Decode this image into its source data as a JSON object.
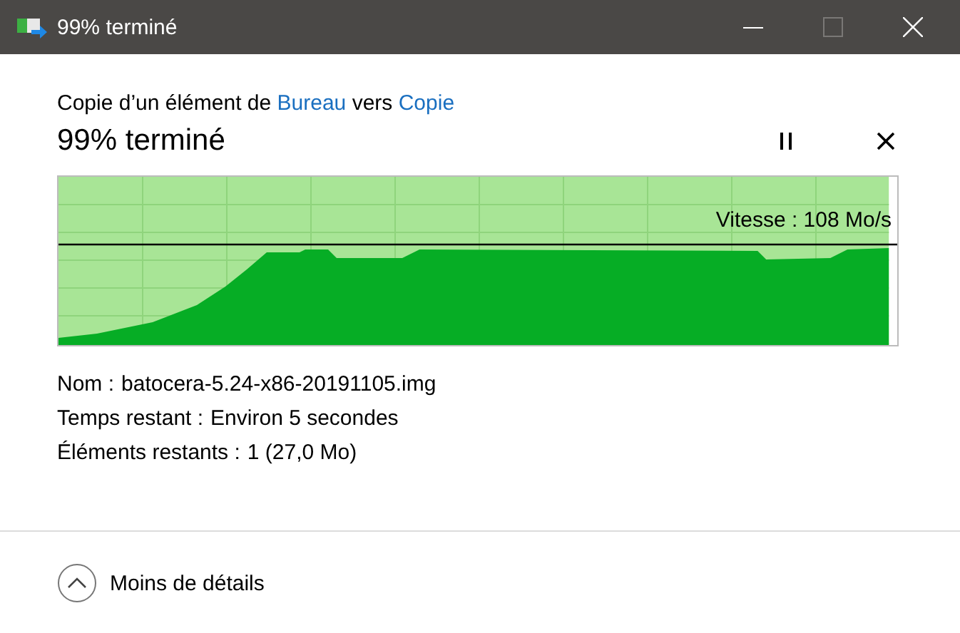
{
  "window": {
    "title": "99% terminé",
    "controls": [
      {
        "kind": "minimize",
        "disabled": false
      },
      {
        "kind": "maximize",
        "disabled": true
      },
      {
        "kind": "close",
        "disabled": false
      }
    ]
  },
  "header": {
    "prefix": "Copie d’un élément de",
    "source": "Bureau",
    "connector": "vers",
    "destination": "Copie"
  },
  "status": {
    "title": "99% terminé"
  },
  "progress": {
    "level": 0.99,
    "speed": "Vitesse : 108 Mo/s"
  },
  "details": [
    {
      "label": "Nom :",
      "value": "batocera-5.24-x86-20191105.img"
    },
    {
      "label": "Temps restant :",
      "value": "Environ 5 secondes"
    },
    {
      "label": "Éléments restants :",
      "value": "1 (27,0 Mo)"
    }
  ],
  "footer": {
    "label": "Moins de détails",
    "expanded": true
  }
}
